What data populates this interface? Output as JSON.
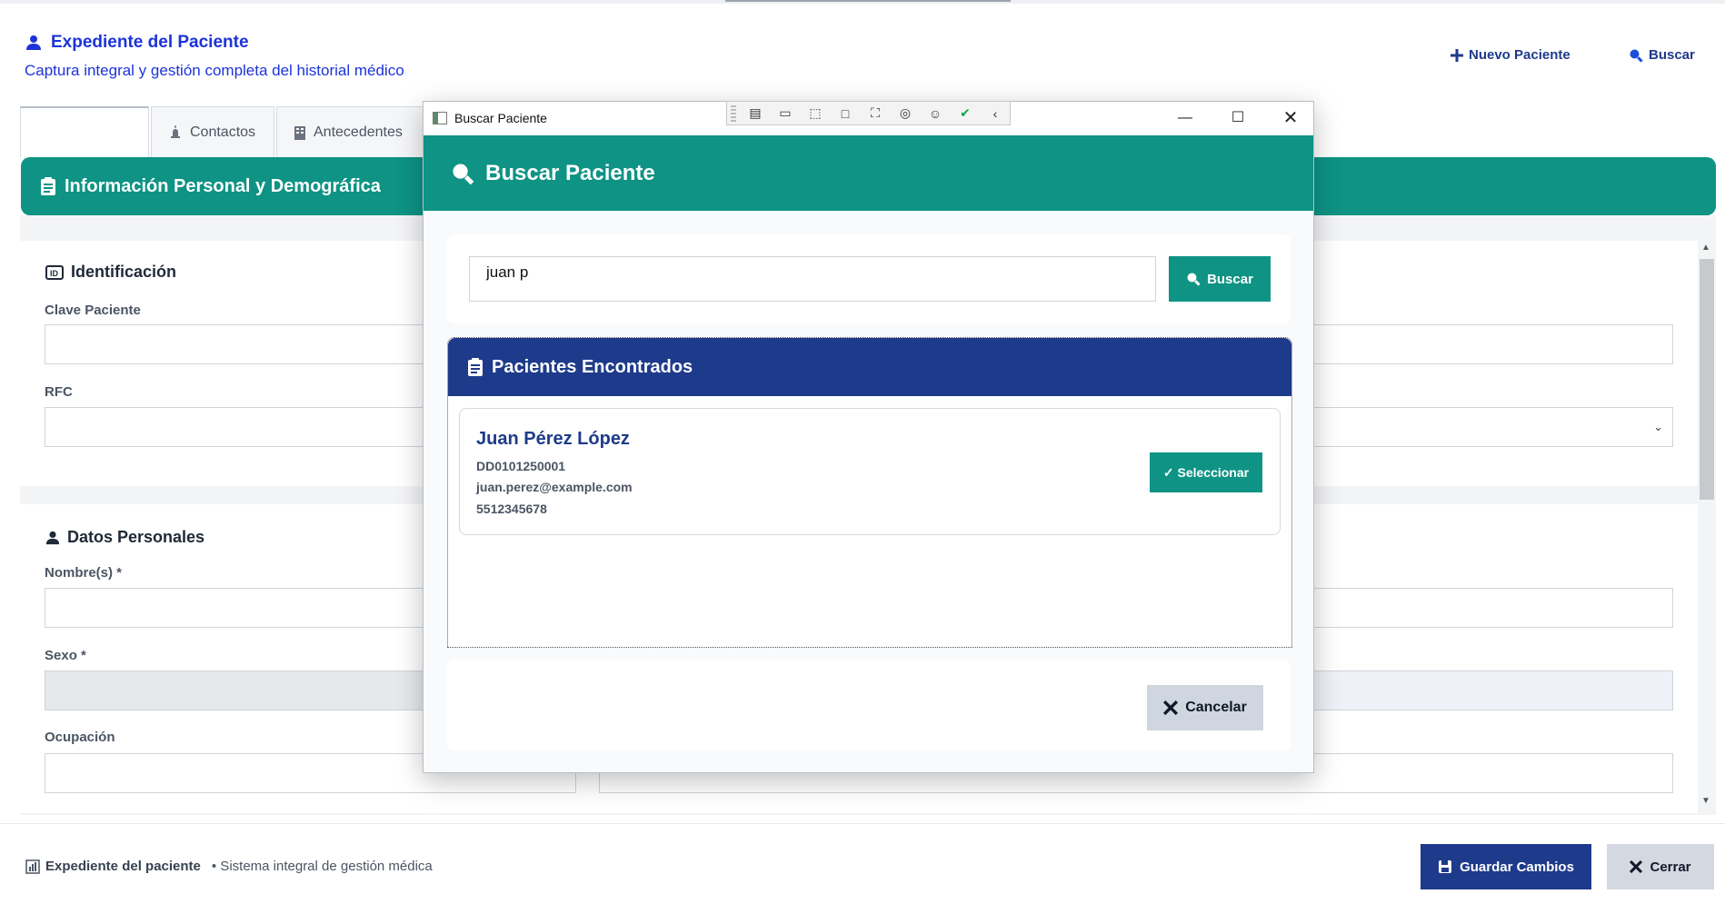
{
  "app": {
    "title": "Expediente del Paciente",
    "subtitle": "Captura integral y gestión completa del historial médico",
    "new_patient_label": "Nuevo Paciente",
    "search_label": "Buscar"
  },
  "tabs": [
    {
      "label": ""
    },
    {
      "label": "Contactos"
    },
    {
      "label": "Antecedentes"
    }
  ],
  "section": {
    "title": "Información Personal y Demográfica"
  },
  "identification": {
    "heading": "Identificación",
    "clave_label": "Clave Paciente",
    "rfc_label": "RFC"
  },
  "personal": {
    "heading": "Datos Personales",
    "nombre_label": "Nombre(s) *",
    "sexo_label": "Sexo *",
    "ocupacion_label": "Ocupación"
  },
  "footer": {
    "app_name": "Expediente del paciente",
    "tagline": "• Sistema integral de gestión médica",
    "save_label": "Guardar Cambios",
    "close_label": "Cerrar"
  },
  "window": {
    "title": "Buscar Paciente"
  },
  "modal": {
    "heading": "Buscar Paciente",
    "search_value": "juan p",
    "search_button": "Buscar",
    "results_heading": "Pacientes Encontrados",
    "results": [
      {
        "name": "Juan Pérez López",
        "clave": "DD0101250001",
        "email": "juan.perez@example.com",
        "phone": "5512345678",
        "select_label": "✓ Seleccionar"
      }
    ],
    "cancel_label": "Cancelar"
  },
  "colors": {
    "teal": "#0e9384",
    "navy": "#1e3a8a",
    "title_blue": "#1d33d8"
  }
}
